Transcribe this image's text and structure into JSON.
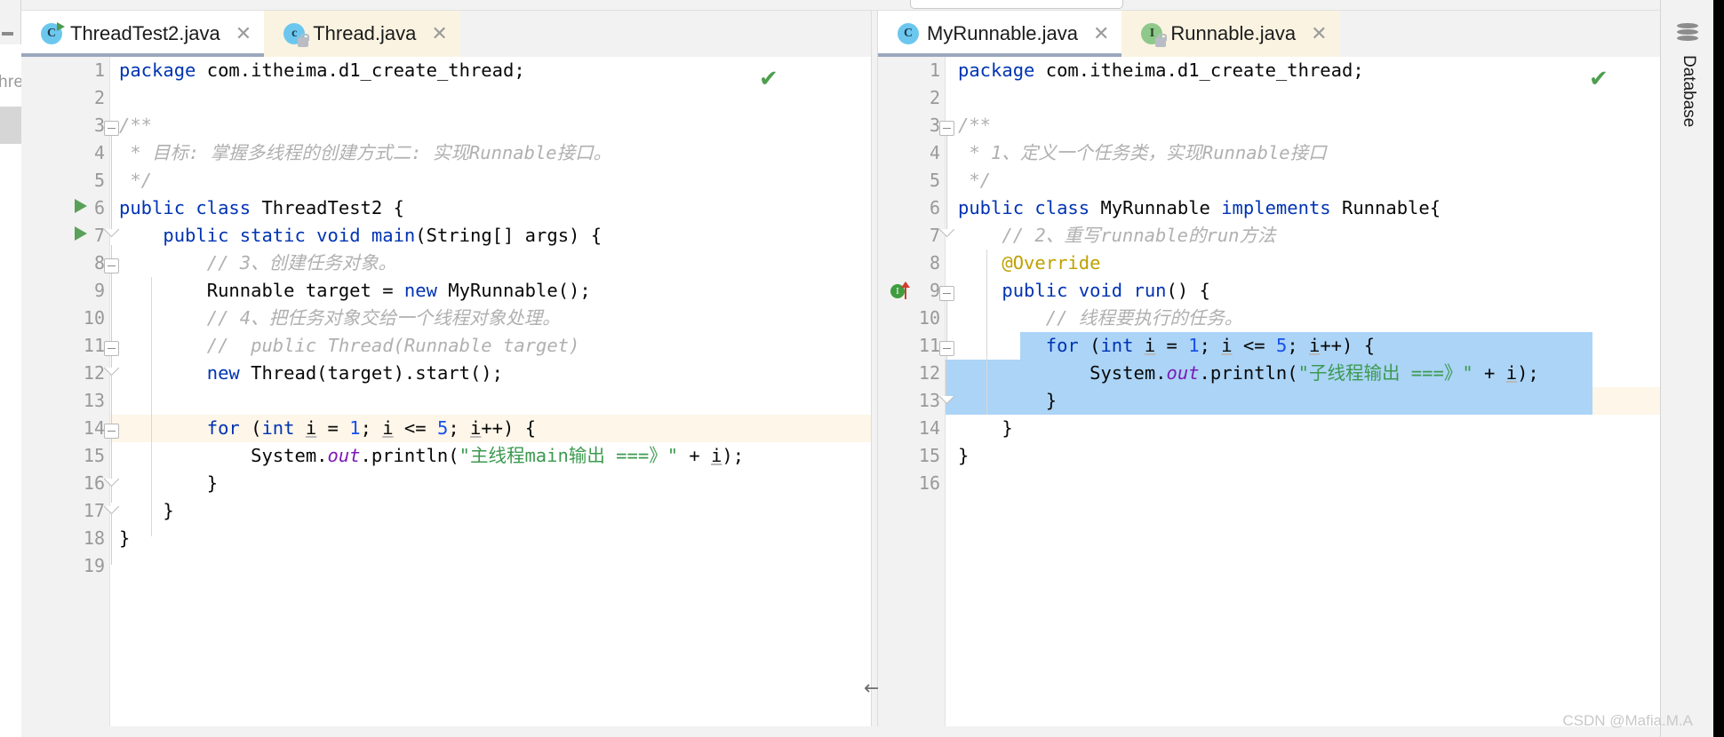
{
  "window": {
    "watermark": "CSDN @Mafia.M.A"
  },
  "left_sliver": {
    "truncated_label": "hre"
  },
  "right_toolwindow": {
    "database_label": "Database",
    "database_icon": "database-icon"
  },
  "splitter": {
    "handle_icon": "horizontal-resize-icon",
    "handle_glyph": "⟷"
  },
  "left_editor": {
    "tabs": [
      {
        "label": "ThreadTest2.java",
        "icon": "java-class-runnable-icon",
        "active": true,
        "close_icon": "✕"
      },
      {
        "label": "Thread.java",
        "icon": "java-class-readonly-icon",
        "active": false,
        "close_icon": "✕"
      }
    ],
    "inspection_status_icon": "green-checkmark-icon",
    "inspection_status_glyph": "✔",
    "caret_line": 13,
    "lines": [
      {
        "n": 1,
        "text": "package com.itheima.d1_create_thread;"
      },
      {
        "n": 2,
        "text": ""
      },
      {
        "n": 3,
        "text": "/**"
      },
      {
        "n": 4,
        "text": " * 目标: 掌握多线程的创建方式二: 实现Runnable接口。"
      },
      {
        "n": 5,
        "text": " */"
      },
      {
        "n": 6,
        "text": "public class ThreadTest2 {"
      },
      {
        "n": 7,
        "text": "    public static void main(String[] args) {"
      },
      {
        "n": 8,
        "text": "        // 3、创建任务对象。"
      },
      {
        "n": 9,
        "text": "        Runnable target = new MyRunnable();"
      },
      {
        "n": 10,
        "text": "        // 4、把任务对象交给一个线程对象处理。"
      },
      {
        "n": 11,
        "text": "        //  public Thread(Runnable target)"
      },
      {
        "n": 12,
        "text": "        new Thread(target).start();"
      },
      {
        "n": 13,
        "text": ""
      },
      {
        "n": 14,
        "text": "        for (int i = 1; i <= 5; i++) {"
      },
      {
        "n": 15,
        "text": "            System.out.println(\"主线程main输出 ===》\" + i);"
      },
      {
        "n": 16,
        "text": "        }"
      },
      {
        "n": 17,
        "text": "    }"
      },
      {
        "n": 18,
        "text": "}"
      },
      {
        "n": 19,
        "text": ""
      }
    ],
    "run_markers": [
      6,
      7
    ]
  },
  "right_editor": {
    "tabs": [
      {
        "label": "MyRunnable.java",
        "icon": "java-class-icon",
        "active": true,
        "close_icon": "✕"
      },
      {
        "label": "Runnable.java",
        "icon": "java-interface-readonly-icon",
        "active": false,
        "close_icon": "✕"
      }
    ],
    "inspection_status_icon": "green-checkmark-icon",
    "inspection_status_glyph": "✔",
    "gutter_implements_line": 9,
    "gutter_implements_icon": "implements-method-icon",
    "selection_lines": [
      11,
      12,
      13
    ],
    "caret_line": 13,
    "lines": [
      {
        "n": 1,
        "text": "package com.itheima.d1_create_thread;"
      },
      {
        "n": 2,
        "text": ""
      },
      {
        "n": 3,
        "text": "/**"
      },
      {
        "n": 4,
        "text": " * 1、定义一个任务类，实现Runnable接口"
      },
      {
        "n": 5,
        "text": " */"
      },
      {
        "n": 6,
        "text": "public class MyRunnable implements Runnable{"
      },
      {
        "n": 7,
        "text": "    // 2、重写runnable的run方法"
      },
      {
        "n": 8,
        "text": "    @Override"
      },
      {
        "n": 9,
        "text": "    public void run() {"
      },
      {
        "n": 10,
        "text": "        // 线程要执行的任务。"
      },
      {
        "n": 11,
        "text": "        for (int i = 1; i <= 5; i++) {"
      },
      {
        "n": 12,
        "text": "            System.out.println(\"子线程输出 ===》\" + i);"
      },
      {
        "n": 13,
        "text": "        }"
      },
      {
        "n": 14,
        "text": "    }"
      },
      {
        "n": 15,
        "text": "}"
      },
      {
        "n": 16,
        "text": ""
      }
    ]
  },
  "colors": {
    "keyword": "#0033b3",
    "string": "#3c9a50",
    "comment": "#b0b0b0",
    "number": "#1750eb",
    "annotation": "#bfa100",
    "field": "#7d1ab6",
    "selection": "#a6d2f7",
    "caret_line": "#fdf6e9",
    "active_tab_underline": "#9aa7bd",
    "inactive_tab_bg": "#faf3e1"
  }
}
